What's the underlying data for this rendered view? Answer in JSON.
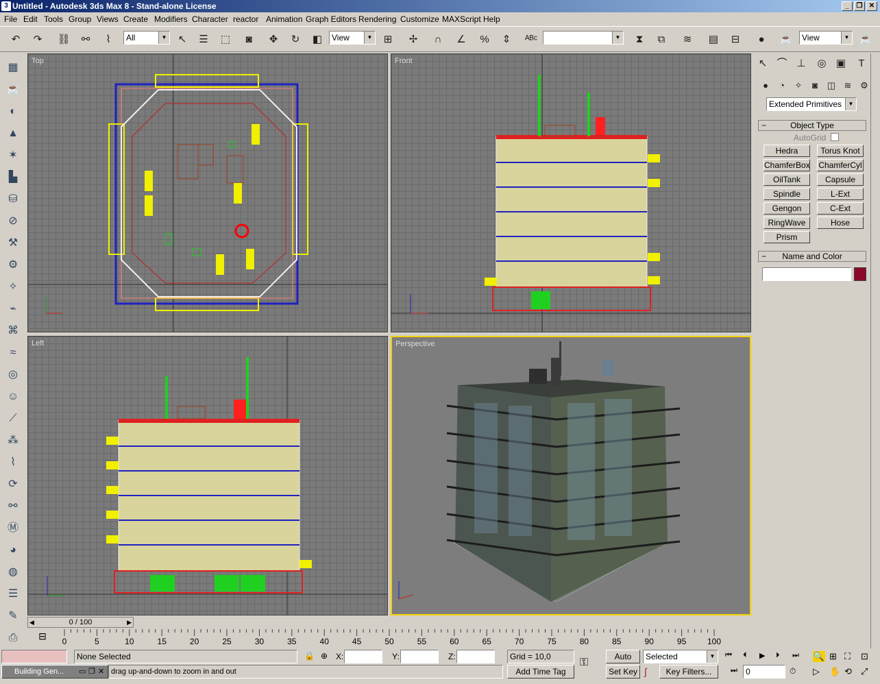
{
  "window": {
    "title": "Untitled - Autodesk 3ds Max 8  - Stand-alone License"
  },
  "menu": [
    "File",
    "Edit",
    "Tools",
    "Group",
    "Views",
    "Create",
    "Modifiers",
    "Character",
    "reactor",
    "Animation",
    "Graph Editors",
    "Rendering",
    "Customize",
    "MAXScript",
    "Help"
  ],
  "toolbar": {
    "selection_filter": "All",
    "ref_coord": "View",
    "named_sel": "",
    "render_view": "View"
  },
  "viewports": {
    "top": "Top",
    "front": "Front",
    "left": "Left",
    "perspective": "Perspective"
  },
  "command_panel": {
    "category": "Extended Primitives",
    "object_type_title": "Object Type",
    "autogrid_label": "AutoGrid",
    "buttons": [
      "Hedra",
      "Torus Knot",
      "ChamferBox",
      "ChamferCyl",
      "OilTank",
      "Capsule",
      "Spindle",
      "L-Ext",
      "Gengon",
      "C-Ext",
      "RingWave",
      "Hose",
      "Prism"
    ],
    "name_color_title": "Name and Color",
    "name_value": "",
    "object_color": "#8b0a2a"
  },
  "timeline": {
    "slider_text": "0 / 100",
    "ticks": [
      "0",
      "5",
      "10",
      "15",
      "20",
      "25",
      "30",
      "35",
      "40",
      "45",
      "50",
      "55",
      "60",
      "65",
      "70",
      "75",
      "80",
      "85",
      "90",
      "95",
      "100"
    ]
  },
  "status": {
    "selection": "None Selected",
    "prompt": "drag up-and-down to zoom in and out",
    "x_label": "X:",
    "y_label": "Y:",
    "z_label": "Z:",
    "grid": "Grid = 10,0",
    "add_time_tag": "Add Time Tag",
    "auto_key": "Auto Key",
    "set_key": "Set Key",
    "key_mode": "Selected",
    "key_filters": "Key Filters...",
    "frame": "0",
    "taskbar_item": "Building Gen..."
  },
  "colors": {
    "accent": "#f4d000",
    "titlebar": "#0a246a"
  }
}
